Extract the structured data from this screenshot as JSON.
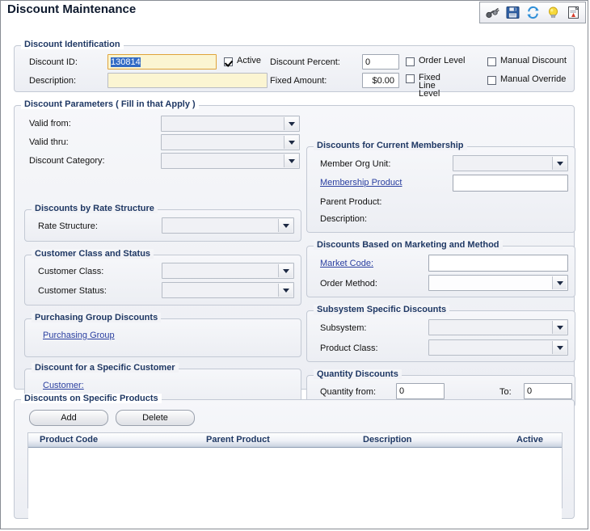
{
  "window": {
    "title": "Discount Maintenance"
  },
  "toolbar": {
    "items": [
      {
        "name": "binoculars-icon",
        "label": "Find"
      },
      {
        "name": "save-icon",
        "label": "Save"
      },
      {
        "name": "refresh-icon",
        "label": "Refresh"
      },
      {
        "name": "lightbulb-icon",
        "label": "Hint"
      },
      {
        "name": "report-icon",
        "label": "Report"
      }
    ]
  },
  "identification": {
    "legend": "Discount Identification",
    "discount_id_label": "Discount ID:",
    "discount_id_value": "130814",
    "description_label": "Description:",
    "description_value": "",
    "active_label": "Active",
    "active_checked": true,
    "discount_percent_label": "Discount Percent:",
    "discount_percent_value": "0",
    "fixed_amount_label": "Fixed Amount:",
    "fixed_amount_value": "$0.00",
    "order_level_label": "Order Level",
    "order_level_checked": false,
    "fixed_line_level_label": "Fixed Line Level",
    "fixed_line_level_checked": false,
    "manual_discount_label": "Manual Discount",
    "manual_discount_checked": false,
    "manual_override_label": "Manual Override",
    "manual_override_checked": false
  },
  "parameters": {
    "legend": "Discount Parameters ( Fill in that Apply )",
    "valid_from_label": "Valid from:",
    "valid_from_value": "",
    "valid_thru_label": "Valid thru:",
    "valid_thru_value": "",
    "discount_category_label": "Discount Category:",
    "discount_category_value": ""
  },
  "rate_structure": {
    "legend": "Discounts by Rate Structure",
    "rate_structure_label": "Rate Structure:",
    "rate_structure_value": ""
  },
  "customer_class": {
    "legend": "Customer Class and Status",
    "customer_class_label": "Customer Class:",
    "customer_class_value": "",
    "customer_status_label": "Customer Status:",
    "customer_status_value": ""
  },
  "purchasing_group": {
    "legend": "Purchasing Group Discounts",
    "purchasing_group_link": "Purchasing Group"
  },
  "specific_customer": {
    "legend": "Discount for a Specific Customer",
    "customer_link": "Customer:"
  },
  "membership": {
    "legend": "Discounts for Current Membership",
    "member_org_unit_label": "Member Org Unit:",
    "member_org_unit_value": "",
    "membership_product_link": "Membership Product",
    "membership_product_value": "",
    "parent_product_label": "Parent Product:",
    "parent_product_value": "",
    "description_label": "Description:",
    "description_value": ""
  },
  "marketing": {
    "legend": "Discounts Based on Marketing and Method",
    "market_code_link": "Market Code:",
    "market_code_value": "",
    "order_method_label": "Order Method:",
    "order_method_value": ""
  },
  "subsystem": {
    "legend": "Subsystem Specific Discounts",
    "subsystem_label": "Subsystem:",
    "subsystem_value": "",
    "product_class_label": "Product Class:",
    "product_class_value": ""
  },
  "quantity": {
    "legend": "Quantity Discounts",
    "quantity_from_label": "Quantity from:",
    "quantity_from_value": "0",
    "to_label": "To:",
    "to_value": "0"
  },
  "products": {
    "legend": "Discounts on Specific Products",
    "add_button": "Add",
    "delete_button": "Delete",
    "columns": [
      "Product Code",
      "Parent Product",
      "Description",
      "Active"
    ],
    "rows": []
  }
}
